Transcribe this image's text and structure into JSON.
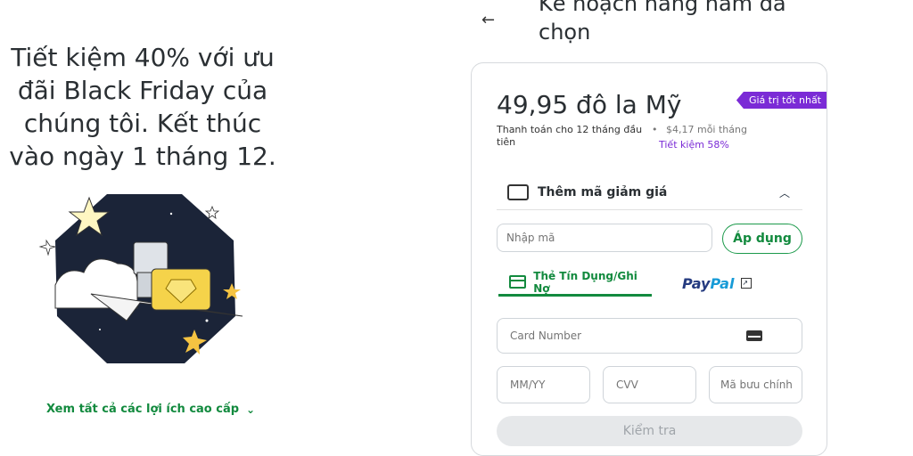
{
  "promo": {
    "headline": "Tiết kiệm 40% với ưu đãi Black Friday của chúng tôi. Kết thúc vào ngày 1 tháng 12.",
    "benefits_link": "Xem tất cả các lợi ích cao cấp"
  },
  "plan": {
    "title": "Kế hoạch hàng năm đã chọn",
    "price": "49,95 đô la Mỹ",
    "badge": "Giá trị tốt nhất",
    "billing_note": "Thanh toán cho 12 tháng đầu tiên",
    "monthly": "$4,17 mỗi tháng",
    "savings": "Tiết kiệm 58%"
  },
  "discount": {
    "label": "Thêm mã giảm giá",
    "code_placeholder": "Nhập mã",
    "apply_label": "Áp dụng"
  },
  "payment": {
    "tab_card": "Thẻ Tín Dụng/Ghi Nợ",
    "tab_paypal_a": "Pay",
    "tab_paypal_b": "Pal",
    "card_number_placeholder": "Card Number",
    "expiry_placeholder": "MM/YY",
    "cvv_placeholder": "CVV",
    "zip_placeholder": "Mã bưu chính",
    "submit_label": "Kiểm tra"
  },
  "colors": {
    "accent": "#128a3e",
    "badge": "#7b2bd6",
    "paypal_dark": "#253b80",
    "paypal_light": "#179bd7"
  }
}
